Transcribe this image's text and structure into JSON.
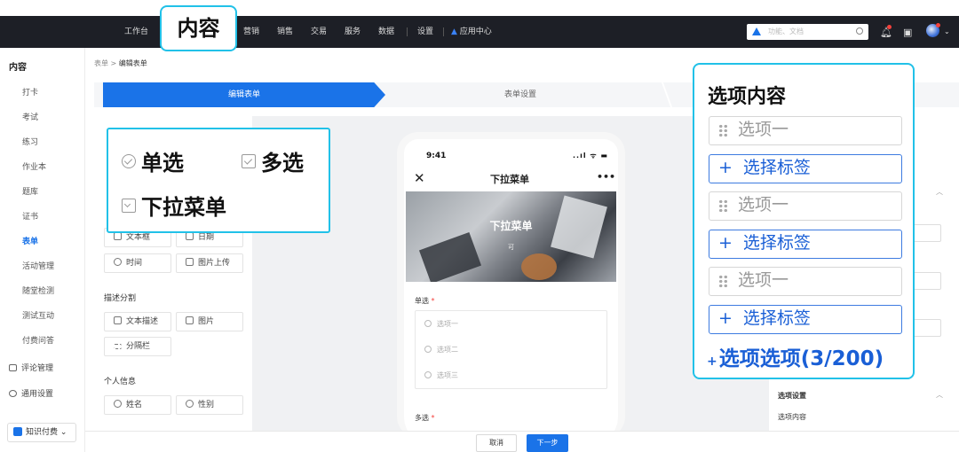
{
  "topnav": {
    "items": [
      "工作台",
      "营销",
      "销售",
      "交易",
      "服务",
      "数据",
      "设置",
      "应用中心"
    ],
    "highlight": "内容",
    "search_placeholder": "功能、文档"
  },
  "sidebar": {
    "header": "内容",
    "items": [
      "打卡",
      "考试",
      "练习",
      "作业本",
      "题库",
      "证书",
      "表单",
      "活动管理",
      "随堂检测",
      "测试互动",
      "付费问答"
    ],
    "active": "表单",
    "bottom_items": [
      "评论管理",
      "通用设置"
    ],
    "product": "知识付费"
  },
  "breadcrumb": {
    "parent": "表单",
    "sep": ">",
    "current": "编辑表单"
  },
  "steps": [
    "编辑表单",
    "表单设置"
  ],
  "left_panel": {
    "chips_row1": [
      "文本框",
      "日期"
    ],
    "chips_row2": [
      "时间",
      "图片上传"
    ],
    "section_desc": "描述分割",
    "chips_row3": [
      "文本描述",
      "图片"
    ],
    "chips_row4": [
      "分隔栏"
    ],
    "section_personal": "个人信息",
    "chips_row5": [
      "姓名",
      "性别"
    ]
  },
  "phone": {
    "time": "9:41",
    "status": "..ıl ᯤ ▬",
    "title": "下拉菜单",
    "more": "•••",
    "banner_title": "下拉菜单",
    "banner_sub": "可",
    "q1_label": "单选",
    "required": "*",
    "q1_options": [
      "选项一",
      "选项二",
      "选项三"
    ],
    "q2_label": "多选"
  },
  "right_panel": {
    "section": "选项设置",
    "content_label": "选项内容"
  },
  "footer": {
    "cancel": "取消",
    "next": "下一步"
  },
  "popup_types": {
    "single": "单选",
    "multi": "多选",
    "dropdown": "下拉菜单"
  },
  "popup_options": {
    "title": "选项内容",
    "option": "选项一",
    "tag": "选择标签",
    "plus": "+",
    "footer": "选项选项(3/200)"
  },
  "colors": {
    "accent": "#1a73e8",
    "highlight_border": "#21c1e8",
    "topbar": "#1d1f26"
  }
}
